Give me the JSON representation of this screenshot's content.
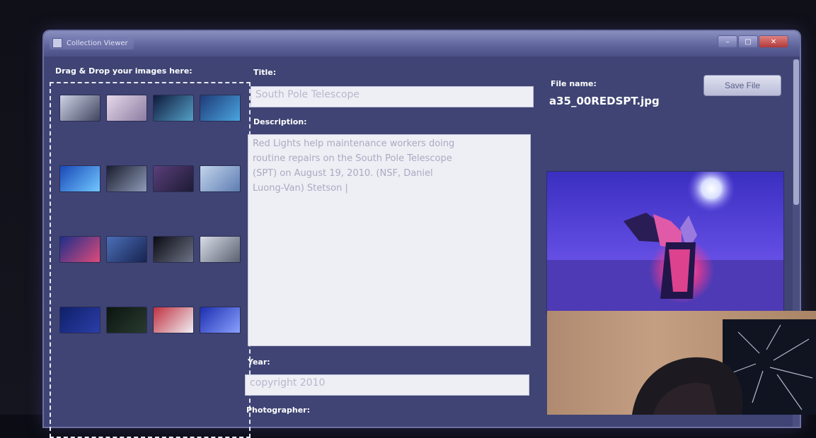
{
  "window": {
    "title": "Collection Viewer",
    "controls": [
      "–",
      "□",
      "✕"
    ]
  },
  "drop_zone": {
    "label": "Drag & Drop your images here:",
    "thumbnails": [
      {
        "id": "t1",
        "c1": "#cfd3e6",
        "c2": "#40455f"
      },
      {
        "id": "t2",
        "c1": "#e7d9ea",
        "c2": "#8c7ca2"
      },
      {
        "id": "t3",
        "c1": "#0f1a3a",
        "c2": "#54a0c8"
      },
      {
        "id": "t4",
        "c1": "#1e3b78",
        "c2": "#4aa5e0"
      },
      {
        "id": "t5",
        "c1": "#1a48b8",
        "c2": "#70c8ff"
      },
      {
        "id": "t6",
        "c1": "#1a1d2e",
        "c2": "#8f9bb8"
      },
      {
        "id": "t7",
        "c1": "#5a3f7a",
        "c2": "#1d1a34"
      },
      {
        "id": "t8",
        "c1": "#c3d4ec",
        "c2": "#5d7db2"
      },
      {
        "id": "t9",
        "c1": "#1c2f8a",
        "c2": "#e04a7a"
      },
      {
        "id": "t10",
        "c1": "#4c6fb8",
        "c2": "#162350"
      },
      {
        "id": "t11",
        "c1": "#0a0a12",
        "c2": "#6d7386"
      },
      {
        "id": "t12",
        "c1": "#d9dde8",
        "c2": "#5a6070"
      },
      {
        "id": "t13",
        "c1": "#0f1f6a",
        "c2": "#2a3fa8"
      },
      {
        "id": "t14",
        "c1": "#0a150f",
        "c2": "#2a3a30"
      },
      {
        "id": "t15",
        "c1": "#c03040",
        "c2": "#f0f0f4"
      },
      {
        "id": "t16",
        "c1": "#1d2fb0",
        "c2": "#8aa0ff"
      }
    ]
  },
  "form": {
    "title_label": "Title:",
    "title_value": "South Pole Telescope",
    "description_label": "Description:",
    "description_value": "Red Lights help maintenance workers doing\nroutine repairs on the South Pole Telescope\n(SPT) on August 19, 2010. (NSF, Daniel\nLuong-Van) Stetson |",
    "year_label": "Year:",
    "year_value": "copyright 2010",
    "photographer_label": "Photographer:"
  },
  "file": {
    "name_label": "File name:",
    "name_value": "a35_00REDSPT.jpg",
    "save_button": "Save File"
  }
}
